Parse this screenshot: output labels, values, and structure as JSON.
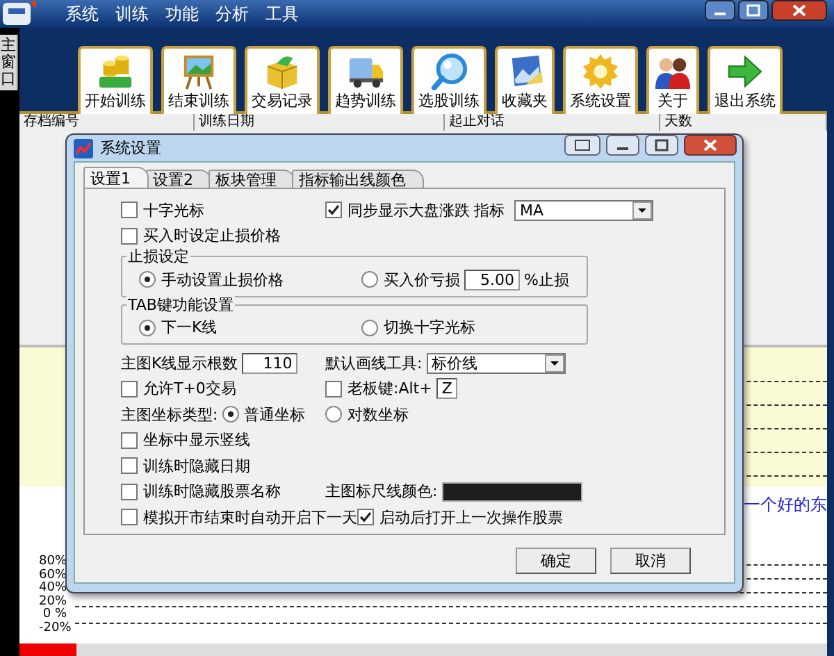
{
  "app": {
    "menu": [
      "系统",
      "训练",
      "功能",
      "分析",
      "工具"
    ],
    "side_tab": "主窗口",
    "toolbar": [
      {
        "label": "开始训练",
        "kind": "coins"
      },
      {
        "label": "结束训练",
        "kind": "easel"
      },
      {
        "label": "交易记录",
        "kind": "box"
      },
      {
        "label": "趋势训练",
        "kind": "truck"
      },
      {
        "label": "选股训练",
        "kind": "magnifier"
      },
      {
        "label": "收藏夹",
        "kind": "photo"
      },
      {
        "label": "系统设置",
        "kind": "gear"
      },
      {
        "label": "关于",
        "kind": "people"
      },
      {
        "label": "退出系统",
        "kind": "arrow"
      }
    ],
    "table": {
      "columns": [
        "存档编号",
        "训练日期",
        "起止对话",
        "天数"
      ]
    },
    "notice": "一个好的东",
    "axis_labels": [
      "80%",
      "60%",
      "40%",
      "20%",
      "0 %",
      "-20%"
    ]
  },
  "dialog": {
    "title": "系统设置",
    "tabs": [
      {
        "label": "设置1",
        "selected": true
      },
      {
        "label": "设置2",
        "selected": false
      },
      {
        "label": "板块管理",
        "selected": false
      },
      {
        "label": "指标输出线颜色",
        "selected": false
      }
    ],
    "rows": [
      {
        "kind": "line",
        "left": [
          {
            "kind": "checkbox",
            "label": "十字光标",
            "checked": false
          }
        ],
        "right": [
          {
            "kind": "checkbox",
            "label": "同步显示大盘涨跌",
            "checked": true
          },
          {
            "kind": "label",
            "text": "指标"
          },
          {
            "kind": "select",
            "value": "MA"
          }
        ]
      },
      {
        "kind": "line",
        "left": [
          {
            "kind": "checkbox",
            "label": "买入时设定止损价格",
            "checked": false
          }
        ]
      },
      {
        "kind": "group",
        "title": "止损设定",
        "left": [
          {
            "kind": "radio",
            "label": "手动设置止损价格",
            "selected": true
          }
        ],
        "right": [
          {
            "kind": "radio",
            "label": "买入价亏损",
            "selected": false
          },
          {
            "kind": "field",
            "value": "5.00"
          },
          {
            "kind": "label",
            "text": "%止损"
          }
        ]
      },
      {
        "kind": "group",
        "title": "TAB键功能设置",
        "left": [
          {
            "kind": "radio",
            "label": "下一K线",
            "selected": true
          }
        ],
        "right": [
          {
            "kind": "radio",
            "label": "切换十字光标",
            "selected": false
          }
        ]
      },
      {
        "kind": "line",
        "left": [
          {
            "kind": "label",
            "text": "主图K线显示根数"
          },
          {
            "kind": "field",
            "value": "110"
          }
        ],
        "right": [
          {
            "kind": "label",
            "text": "默认画线工具:"
          },
          {
            "kind": "select",
            "value": "标价线"
          }
        ]
      },
      {
        "kind": "line",
        "left": [
          {
            "kind": "checkbox",
            "label": "允许T+0交易",
            "checked": false
          }
        ],
        "right": [
          {
            "kind": "checkbox",
            "label": "老板键:Alt+",
            "checked": false
          },
          {
            "kind": "field",
            "value": "Z"
          }
        ]
      },
      {
        "kind": "line",
        "left": [
          {
            "kind": "label",
            "text": "主图坐标类型:"
          },
          {
            "kind": "radio",
            "label": "普通坐标",
            "selected": true
          }
        ],
        "right": [
          {
            "kind": "radio",
            "label": "对数坐标",
            "selected": false
          }
        ]
      },
      {
        "kind": "line",
        "left": [
          {
            "kind": "checkbox",
            "label": "坐标中显示竖线",
            "checked": false
          }
        ]
      },
      {
        "kind": "line",
        "left": [
          {
            "kind": "checkbox",
            "label": "训练时隐藏日期",
            "checked": false
          }
        ]
      },
      {
        "kind": "line",
        "left": [
          {
            "kind": "checkbox",
            "label": "训练时隐藏股票名称",
            "checked": false
          }
        ],
        "right": [
          {
            "kind": "label",
            "text": "主图标尺线颜色:"
          },
          {
            "kind": "color",
            "color": "#1e1e1e"
          }
        ]
      },
      {
        "kind": "line",
        "left": [
          {
            "kind": "checkbox",
            "label": "模拟开市结束时自动开启下一天",
            "checked": false
          }
        ],
        "right": [
          {
            "kind": "checkbox",
            "label": "启动后打开上一次操作股票",
            "checked": true
          }
        ]
      }
    ],
    "buttons": [
      "确定",
      "取消"
    ]
  }
}
